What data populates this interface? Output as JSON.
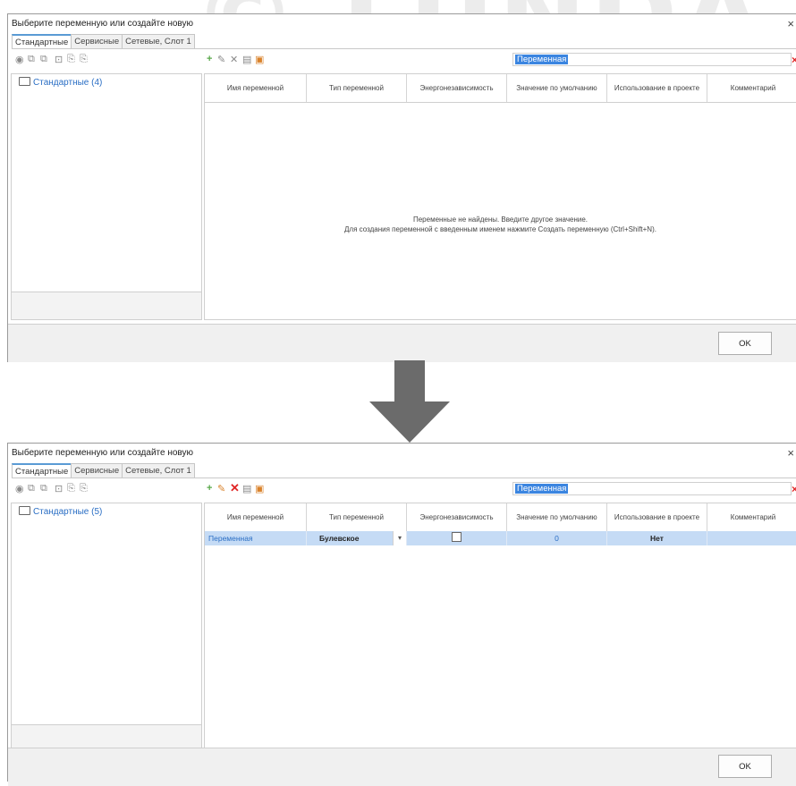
{
  "watermark": "© LUNDA",
  "before": {
    "title": "Выберите переменную или создайте новую",
    "close": "×",
    "tabs": [
      "Стандартные",
      "Сервисные",
      "Сетевые, Слот 1"
    ],
    "search_value": "Переменная",
    "tree_node": "Стандартные (4)",
    "columns": [
      "Имя переменной",
      "Тип переменной",
      "Энергонезависимость",
      "Значение по умолчанию",
      "Использование в проекте",
      "Комментарий"
    ],
    "empty_line1": "Переменные не найдены. Введите другое значение.",
    "empty_line2": "Для создания переменной с введенным именем нажмите Создать переменную (Ctrl+Shift+N).",
    "ok": "OK"
  },
  "after": {
    "title": "Выберите переменную или создайте новую",
    "close": "×",
    "tabs": [
      "Стандартные",
      "Сервисные",
      "Сетевые, Слот 1"
    ],
    "search_value": "Переменная",
    "tree_node": "Стандартные (5)",
    "columns": [
      "Имя переменной",
      "Тип переменной",
      "Энергонезависимость",
      "Значение по умолчанию",
      "Использование в проекте",
      "Комментарий"
    ],
    "row": {
      "name": "Переменная",
      "type": "Булевское",
      "dropdown": "▾",
      "default": "0",
      "usage": "Нет",
      "comment": ""
    },
    "ok": "OK"
  },
  "icons": {
    "tb_left": [
      "view-icon",
      "copy-icon",
      "copy-all-icon",
      "import-icon",
      "export-icon",
      "export-all-icon"
    ],
    "tb_mid": [
      "add-icon",
      "edit-icon",
      "delete-icon",
      "paste-icon",
      "clipboard-icon"
    ],
    "arrow": "down-arrow-icon"
  },
  "colors": {
    "accent": "#3b85e0",
    "row_selection": "#c5dbf5",
    "add": "#59a84a",
    "delete": "#e02525"
  }
}
